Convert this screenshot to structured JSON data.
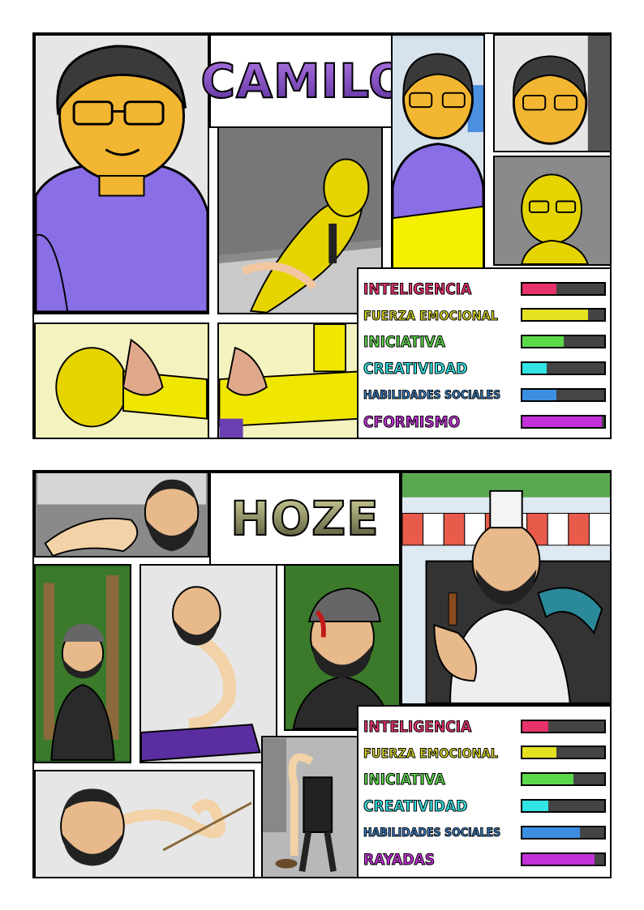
{
  "characters": [
    {
      "id": "camilo",
      "name": "CAMILO",
      "stat_labels": [
        "INTELIGENCIA",
        "FUERZA EMOCIONAL",
        "INICIATIVA",
        "CREATIVIDAD",
        "HABILIDADES SOCIALES",
        "CFORMISMO"
      ],
      "stat_levels": [
        0.42,
        0.8,
        0.5,
        0.3,
        0.42,
        0.97
      ],
      "stat_colors": [
        "#e8336a",
        "#e4e121",
        "#5cd94a",
        "#33e4e4",
        "#3c8fe0",
        "#c431d9"
      ]
    },
    {
      "id": "hoze",
      "name": "HOZE",
      "stat_labels": [
        "INTELIGENCIA",
        "FUERZA EMOCIONAL",
        "INICIATIVA",
        "CREATIVIDAD",
        "HABILIDADES SOCIALES",
        "RAYADAS"
      ],
      "stat_levels": [
        0.32,
        0.42,
        0.62,
        0.32,
        0.7,
        0.88
      ],
      "stat_colors": [
        "#e8336a",
        "#e4e121",
        "#5cd94a",
        "#33e4e4",
        "#3c8fe0",
        "#c431d9"
      ]
    }
  ]
}
